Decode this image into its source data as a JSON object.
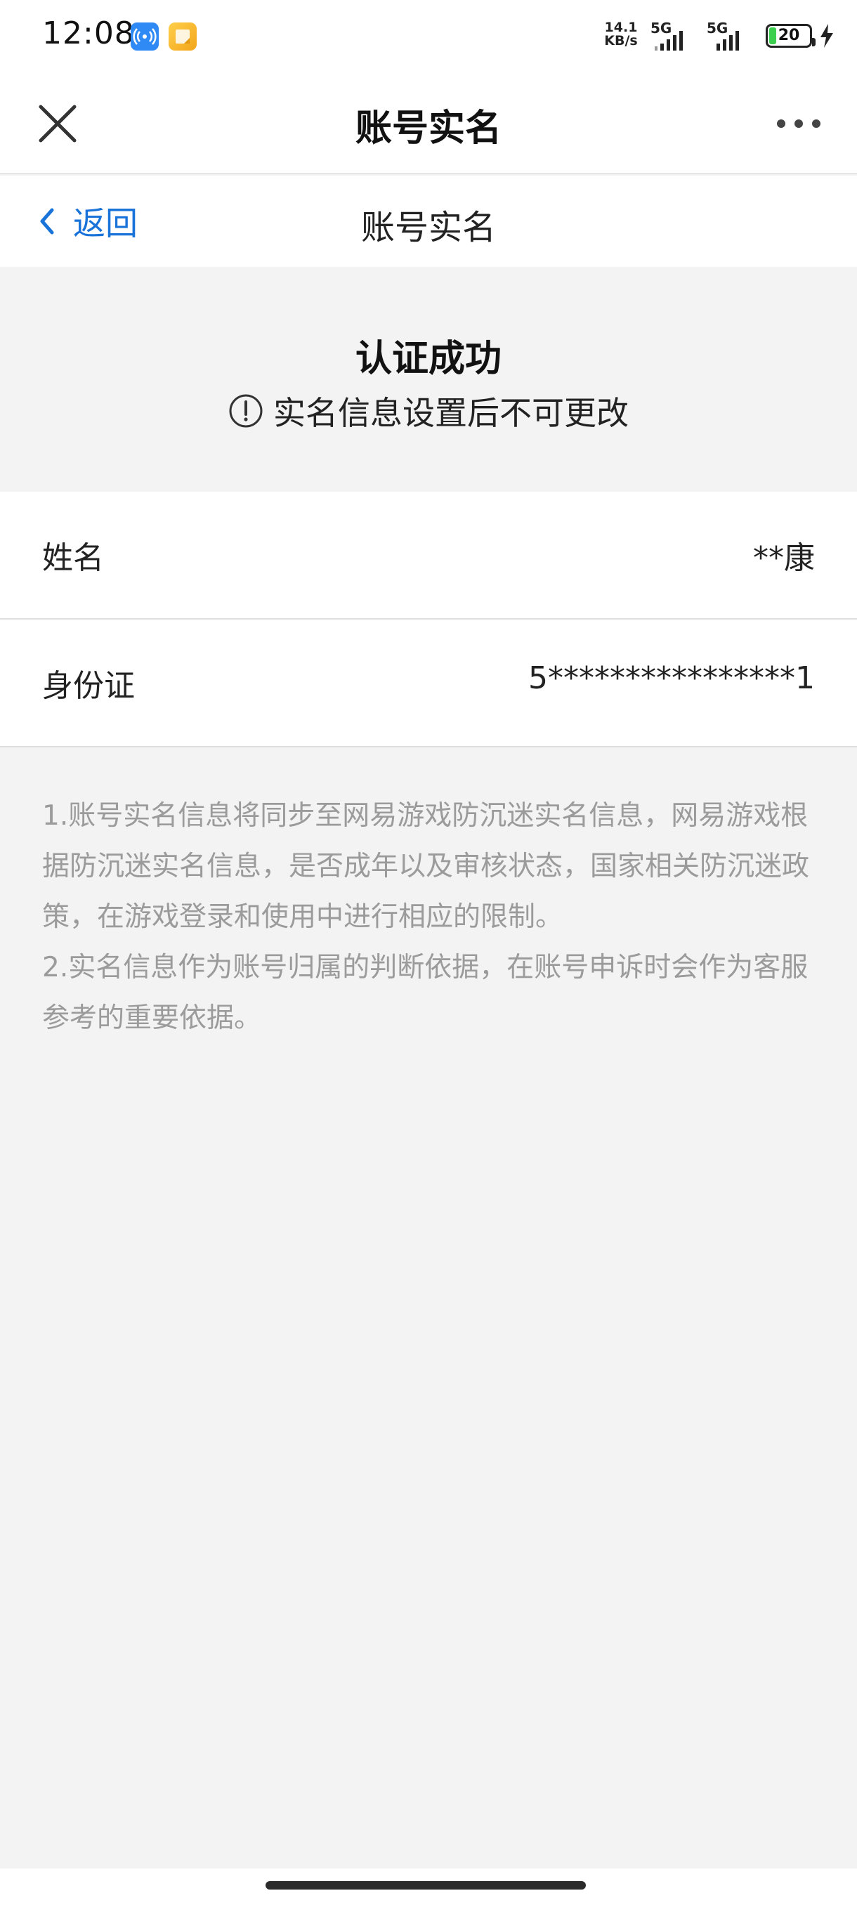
{
  "status_bar": {
    "time": "12:08",
    "net_speed_value": "14.1",
    "net_speed_unit": "KB/s",
    "signal_1_label": "5G",
    "signal_2_label": "5G",
    "battery_level": "20"
  },
  "top_nav": {
    "title": "账号实名"
  },
  "sub_nav": {
    "back_label": "返回",
    "title": "账号实名"
  },
  "status_section": {
    "title": "认证成功",
    "notice": "实名信息设置后不可更改"
  },
  "info": {
    "rows": [
      {
        "label": "姓名",
        "value": "**康"
      },
      {
        "label": "身份证",
        "value": "5****************1"
      }
    ]
  },
  "notes": {
    "items": [
      "1.账号实名信息将同步至网易游戏防沉迷实名信息，网易游戏根据防沉迷实名信息，是否成年以及审核状态，国家相关防沉迷政策，在游戏登录和使用中进行相应的限制。",
      "2.实名信息作为账号归属的判断依据，在账号申诉时会作为客服参考的重要依据。"
    ]
  },
  "colors": {
    "accent_blue": "#1a73d9",
    "note_gray": "#9b9b9b",
    "battery_green": "#3ccf4e"
  },
  "icons": {
    "close": "close-icon",
    "more": "more-dots-icon",
    "back": "chevron-left-icon",
    "notice": "info-exclamation-icon"
  }
}
